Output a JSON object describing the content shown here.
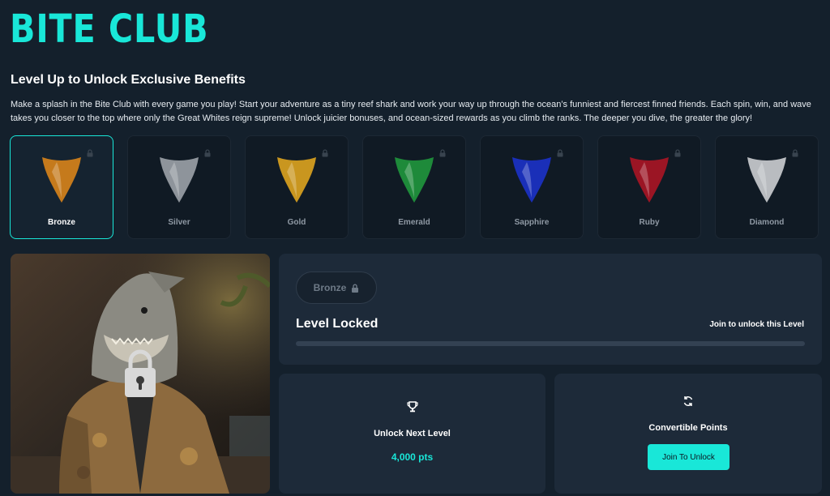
{
  "brand": {
    "logo": "BITE CLUB",
    "accent": "#19e7d8"
  },
  "header": {
    "title": "Level Up to Unlock Exclusive Benefits",
    "description": "Make a splash in the Bite Club with every game you play! Start your adventure as a tiny reef shark and work your way up through the ocean’s funniest and fiercest finned friends. Each spin, win, and wave takes you closer to the top where only the Great Whites reign supreme! Unlock juicier bonuses, and ocean-sized rewards as you climb the ranks. The deeper you dive, the greater the glory!"
  },
  "tiers": [
    {
      "name": "Bronze",
      "color": "#c57a1c",
      "selected": true
    },
    {
      "name": "Silver",
      "color": "#8e949b",
      "selected": false
    },
    {
      "name": "Gold",
      "color": "#c9961f",
      "selected": false
    },
    {
      "name": "Emerald",
      "color": "#1e8a3a",
      "selected": false
    },
    {
      "name": "Sapphire",
      "color": "#1a2fb8",
      "selected": false
    },
    {
      "name": "Ruby",
      "color": "#9b1524",
      "selected": false
    },
    {
      "name": "Diamond",
      "color": "#b9bcc0",
      "selected": false
    }
  ],
  "status": {
    "badge": "Bronze",
    "title": "Level Locked",
    "join_text": "Join to unlock this Level",
    "progress": 0
  },
  "next_level": {
    "label": "Unlock Next Level",
    "value": "4,000 pts",
    "icon": "trophy-icon"
  },
  "points": {
    "label": "Convertible Points",
    "button": "Join To Unlock",
    "icon": "refresh-icon"
  }
}
